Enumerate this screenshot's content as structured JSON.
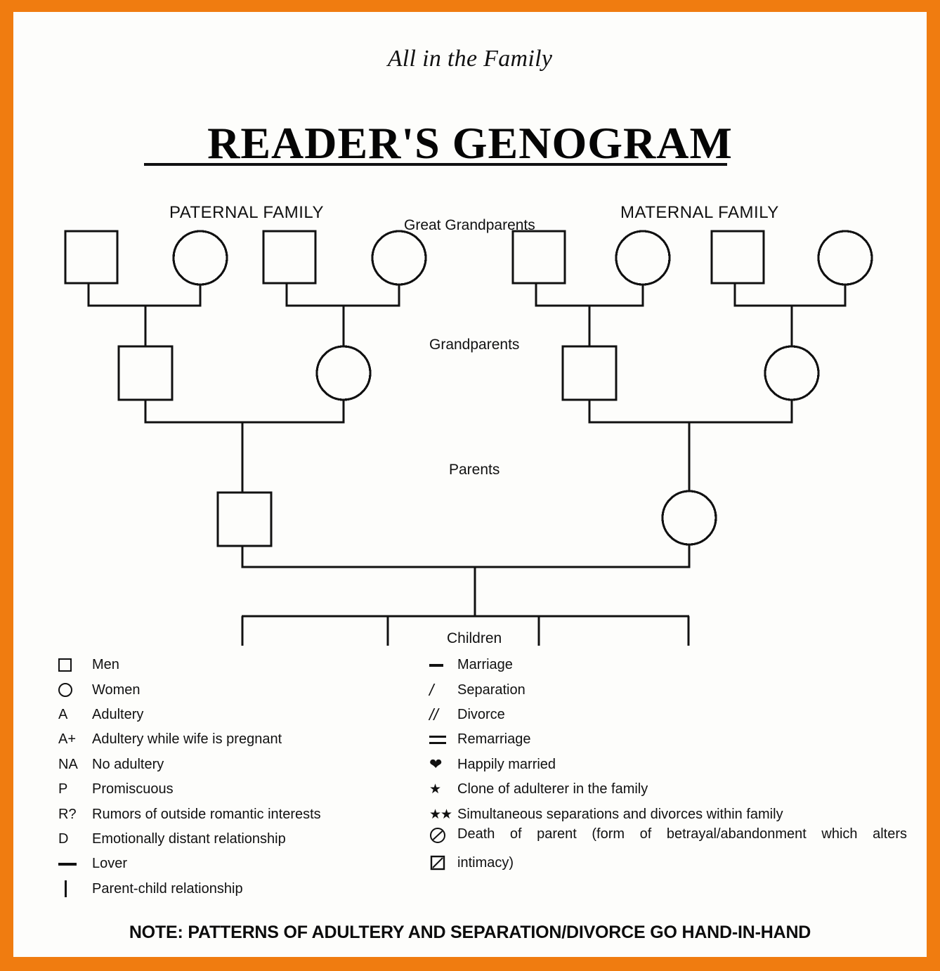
{
  "colors": {
    "border": "#f07c10",
    "paper": "#fdfdfb",
    "ink": "#111111"
  },
  "header": {
    "subtitle": "All in the Family",
    "title": "READER'S GENOGRAM"
  },
  "diagram": {
    "labels": {
      "paternal_family": "PATERNAL FAMILY",
      "maternal_family": "MATERNAL FAMILY",
      "great_grandparents": "Great Grandparents",
      "grandparents": "Grandparents",
      "parents": "Parents",
      "children": "Children"
    },
    "generations": [
      {
        "name": "great-grandparents",
        "couples": [
          {
            "side": "paternal",
            "male": "square",
            "female": "circle"
          },
          {
            "side": "paternal",
            "male": "square",
            "female": "circle"
          },
          {
            "side": "maternal",
            "male": "square",
            "female": "circle"
          },
          {
            "side": "maternal",
            "male": "square",
            "female": "circle"
          }
        ]
      },
      {
        "name": "grandparents",
        "couples": [
          {
            "side": "paternal",
            "male": "square",
            "female": "circle"
          },
          {
            "side": "maternal",
            "male": "square",
            "female": "circle"
          }
        ]
      },
      {
        "name": "parents",
        "couples": [
          {
            "side": "both",
            "male": "square",
            "female": "circle"
          }
        ]
      },
      {
        "name": "children",
        "sibship_stubs": 4
      }
    ]
  },
  "legend": {
    "left": [
      {
        "symbol": "square-icon",
        "label": "Men"
      },
      {
        "symbol": "circle-icon",
        "label": "Women"
      },
      {
        "symbol": "A",
        "label": "Adultery"
      },
      {
        "symbol": "A+",
        "label": "Adultery while wife is pregnant"
      },
      {
        "symbol": "NA",
        "label": "No adultery"
      },
      {
        "symbol": "P",
        "label": "Promiscuous"
      },
      {
        "symbol": "R?",
        "label": "Rumors of outside romantic interests"
      },
      {
        "symbol": "D",
        "label": "Emotionally distant relationship"
      },
      {
        "symbol": "horizontal-line-icon",
        "label": "Lover"
      },
      {
        "symbol": "vertical-line-icon",
        "label": "Parent-child relationship"
      }
    ],
    "right": [
      {
        "symbol": "horizontal-line-icon",
        "label": "Marriage"
      },
      {
        "symbol": "/",
        "label": "Separation"
      },
      {
        "symbol": "//",
        "label": "Divorce"
      },
      {
        "symbol": "double-line-icon",
        "label": "Remarriage"
      },
      {
        "symbol": "heart-icon",
        "label": "Happily married"
      },
      {
        "symbol": "star-icon",
        "label": "Clone of adulterer in the family"
      },
      {
        "symbol": "double-star-icon",
        "label": "Simultaneous separations and divorces within family"
      },
      {
        "symbol": "slashed-circle-icon",
        "label": "Death of parent (form of betrayal/abandonment which alters"
      },
      {
        "symbol": "slashed-square-icon",
        "label": "intimacy)"
      }
    ]
  },
  "note": "NOTE: PATTERNS OF ADULTERY AND SEPARATION/DIVORCE GO HAND-IN-HAND"
}
